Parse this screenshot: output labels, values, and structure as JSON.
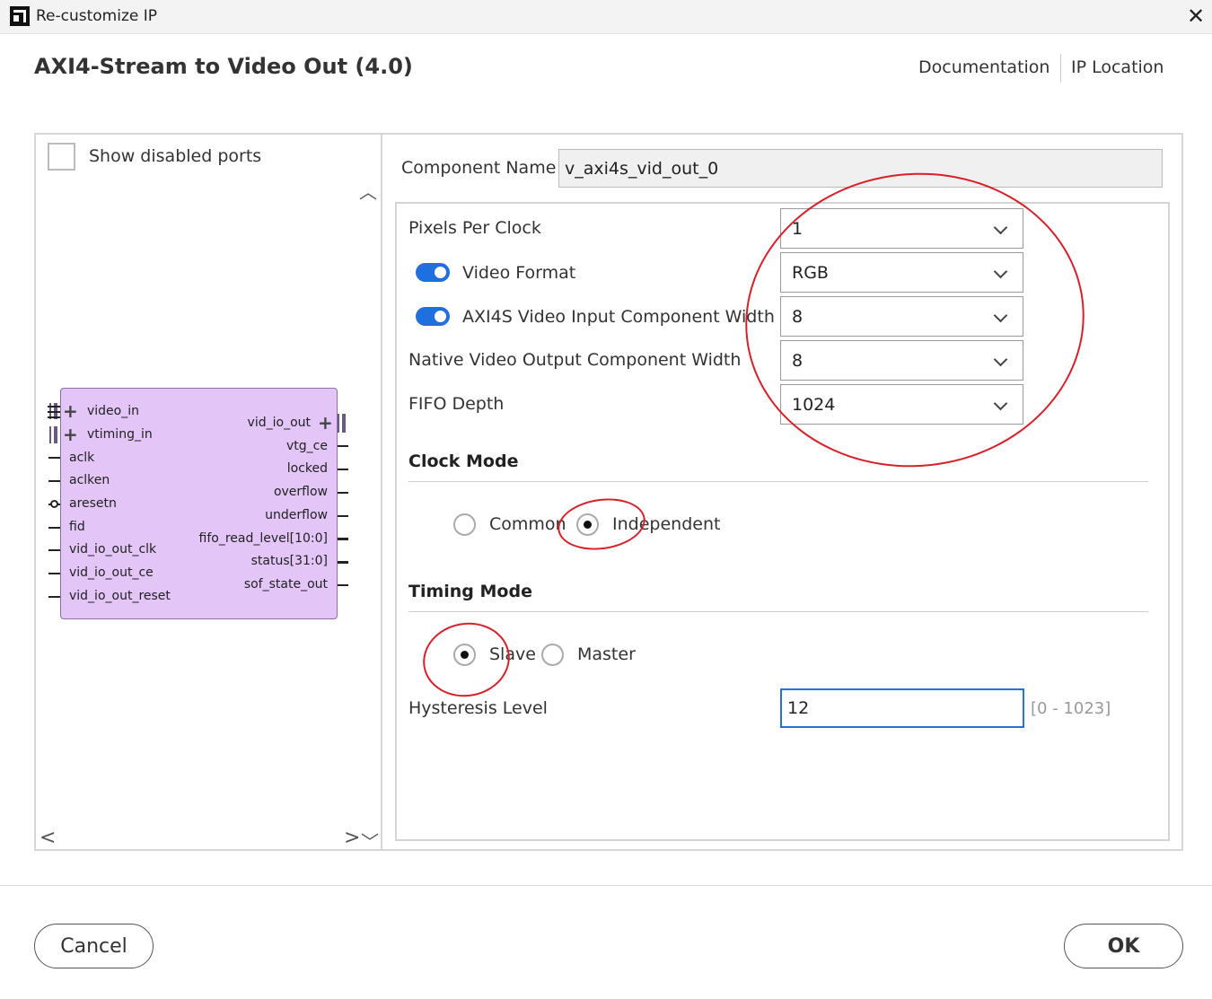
{
  "window": {
    "title": "Re-customize IP",
    "close_glyph": "✕"
  },
  "header": {
    "ip_title": "AXI4-Stream to Video Out (4.0)",
    "documentation": "Documentation",
    "ip_location": "IP Location"
  },
  "symbol_panel": {
    "show_disabled_ports": "Show disabled ports",
    "left_ports": [
      "video_in",
      "vtiming_in",
      "aclk",
      "aclken",
      "aresetn",
      "fid",
      "vid_io_out_clk",
      "vid_io_out_ce",
      "vid_io_out_reset"
    ],
    "right_ports": [
      "vid_io_out",
      "vtg_ce",
      "locked",
      "overflow",
      "underflow",
      "fifo_read_level[10:0]",
      "status[31:0]",
      "sof_state_out"
    ],
    "icons": {
      "scroll_up": "︿",
      "scroll_down": "﹀",
      "scroll_left": "<",
      "scroll_right": ">"
    }
  },
  "config": {
    "component_name_label": "Component Name",
    "component_name_value": "v_axi4s_vid_out_0",
    "pixels_per_clock": {
      "label": "Pixels Per Clock",
      "value": "1"
    },
    "video_format": {
      "label": "Video Format",
      "value": "RGB",
      "toggle_on": true
    },
    "axi4s_width": {
      "label": "AXI4S Video Input Component Width",
      "value": "8",
      "toggle_on": true
    },
    "native_width": {
      "label": "Native Video Output Component Width",
      "value": "8"
    },
    "fifo_depth": {
      "label": "FIFO Depth",
      "value": "1024"
    },
    "clock_mode": {
      "title": "Clock Mode",
      "options": [
        "Common",
        "Independent"
      ],
      "selected": "Independent"
    },
    "timing_mode": {
      "title": "Timing Mode",
      "options": [
        "Slave",
        "Master"
      ],
      "selected": "Slave"
    },
    "hysteresis": {
      "label": "Hysteresis Level",
      "value": "12",
      "range": "[0 - 1023]"
    }
  },
  "annotation_color": "#d7202a",
  "accent_color": "#1f6fe0",
  "ip_block_color": "#e3c5f7",
  "footer": {
    "cancel": "Cancel",
    "ok": "OK"
  }
}
